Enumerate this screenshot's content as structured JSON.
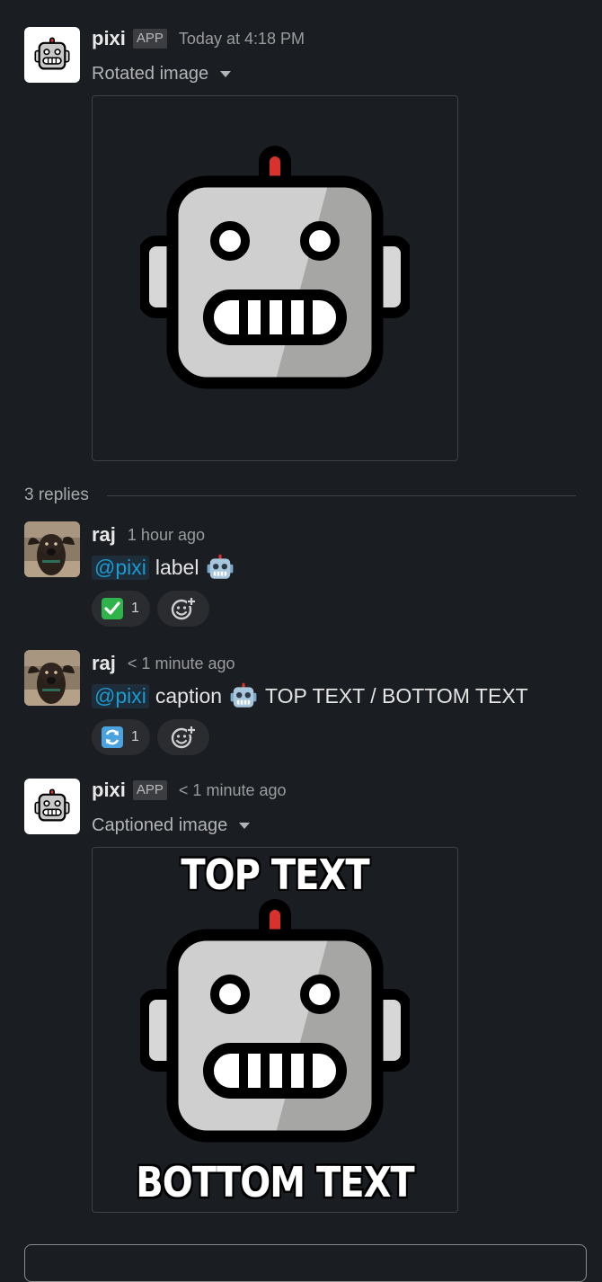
{
  "messages": [
    {
      "author": "pixi",
      "badge": "APP",
      "time": "Today at 4:18 PM",
      "attachment_title": "Rotated image"
    },
    {
      "author": "raj",
      "time": "1 hour ago",
      "mention": "@pixi",
      "text": "label",
      "reaction_count": "1"
    },
    {
      "author": "raj",
      "time": "< 1 minute ago",
      "mention": "@pixi",
      "text": "caption",
      "text_after": "TOP TEXT / BOTTOM TEXT",
      "reaction_count": "1"
    },
    {
      "author": "pixi",
      "badge": "APP",
      "time": "< 1 minute ago",
      "attachment_title": "Captioned image",
      "meme_top": "TOP TEXT",
      "meme_bottom": "BOTTOM TEXT"
    }
  ],
  "thread": {
    "replies_label": "3 replies"
  },
  "icons": {
    "bot_avatar": "robot-face-icon",
    "user_avatar": "dog-photo-avatar",
    "reaction_1": "white-check-mark-icon",
    "reaction_2": "arrows-counterclockwise-icon",
    "add_reaction": "add-emoji-icon",
    "dropdown": "caret-down-icon"
  },
  "colors": {
    "background": "#1a1d21",
    "mention": "#1d9bd1",
    "check_green": "#2eb44a",
    "refresh_blue": "#4aa3df"
  }
}
